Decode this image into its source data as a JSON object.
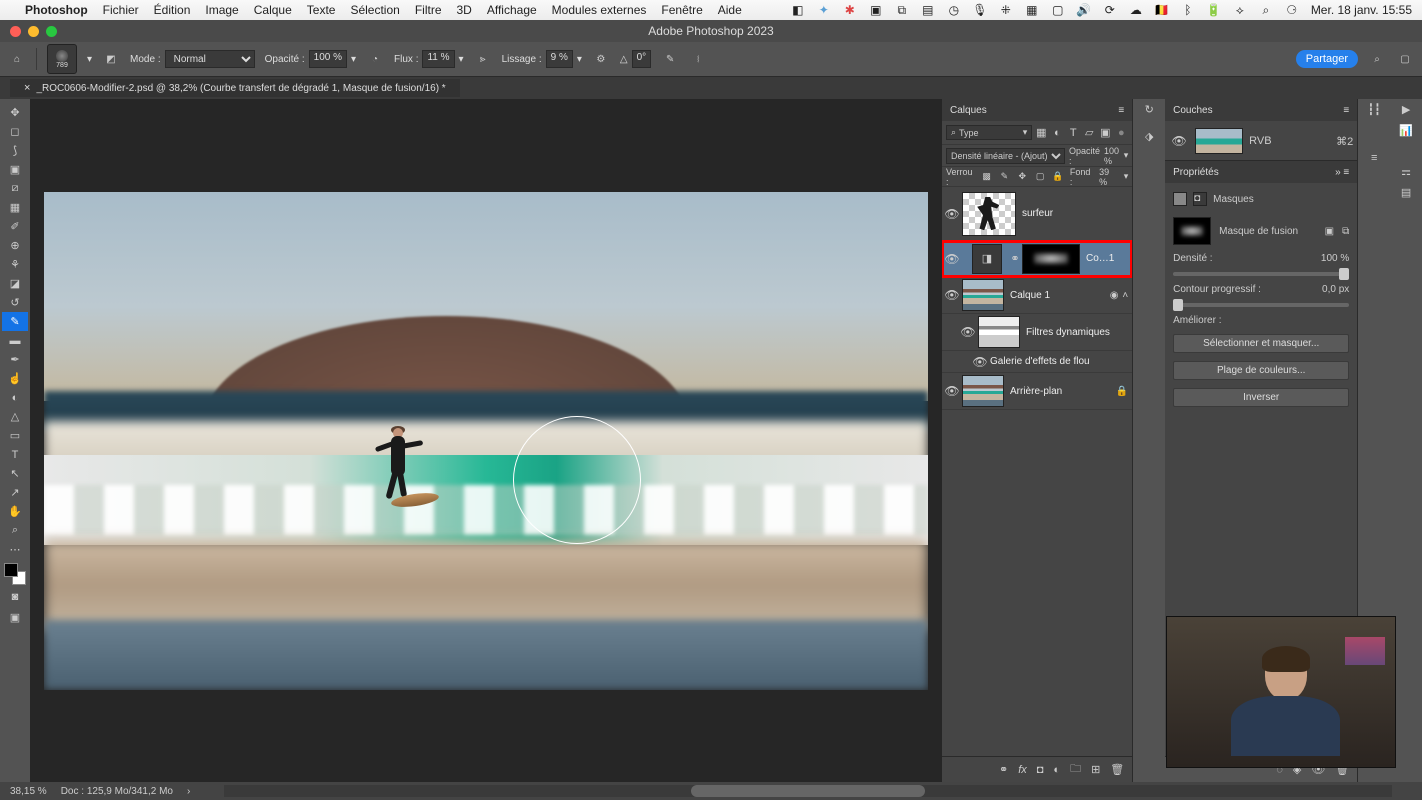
{
  "menubar": {
    "app": "Photoshop",
    "items": [
      "Fichier",
      "Édition",
      "Image",
      "Calque",
      "Texte",
      "Sélection",
      "Filtre",
      "3D",
      "Affichage",
      "Modules externes",
      "Fenêtre",
      "Aide"
    ],
    "clock": "Mer. 18 janv. 15:55"
  },
  "app_title": "Adobe Photoshop 2023",
  "options": {
    "brush_size": "789",
    "mode_label": "Mode :",
    "mode_value": "Normal",
    "opacity_label": "Opacité :",
    "opacity_value": "100 %",
    "flux_label": "Flux :",
    "flux_value": "11 %",
    "lissage_label": "Lissage :",
    "lissage_value": "9 %",
    "angle_label": "△",
    "angle_value": "0°",
    "share": "Partager"
  },
  "tab_title": "_ROC0606-Modifier-2.psd @ 38,2% (Courbe transfert de dégradé 1, Masque de fusion/16) *",
  "layers_panel": {
    "title": "Calques",
    "kind_label": "Type",
    "blend_mode": "Densité linéaire - (Ajout)",
    "opacity_label": "Opacité :",
    "opacity_value": "100 %",
    "lock_label": "Verrou :",
    "fill_label": "Fond :",
    "fill_value": "39 %",
    "layers": [
      {
        "name": "surfeur"
      },
      {
        "name": "Co…1"
      },
      {
        "name": "Calque 1"
      },
      {
        "name": "Filtres dynamiques"
      },
      {
        "name": "Galerie d'effets de flou"
      },
      {
        "name": "Arrière-plan"
      }
    ]
  },
  "couches_panel": {
    "title": "Couches",
    "rvb": "RVB",
    "shortcut": "⌘2"
  },
  "properties_panel": {
    "title": "Propriétés",
    "masques": "Masques",
    "mask_type": "Masque de fusion",
    "density_label": "Densité :",
    "density_value": "100 %",
    "feather_label": "Contour progressif :",
    "feather_value": "0,0 px",
    "refine_label": "Améliorer :",
    "btn_select": "Sélectionner et masquer...",
    "btn_color": "Plage de couleurs...",
    "btn_invert": "Inverser"
  },
  "status": {
    "zoom": "38,15 %",
    "doc": "Doc : 125,9 Mo/341,2 Mo"
  }
}
